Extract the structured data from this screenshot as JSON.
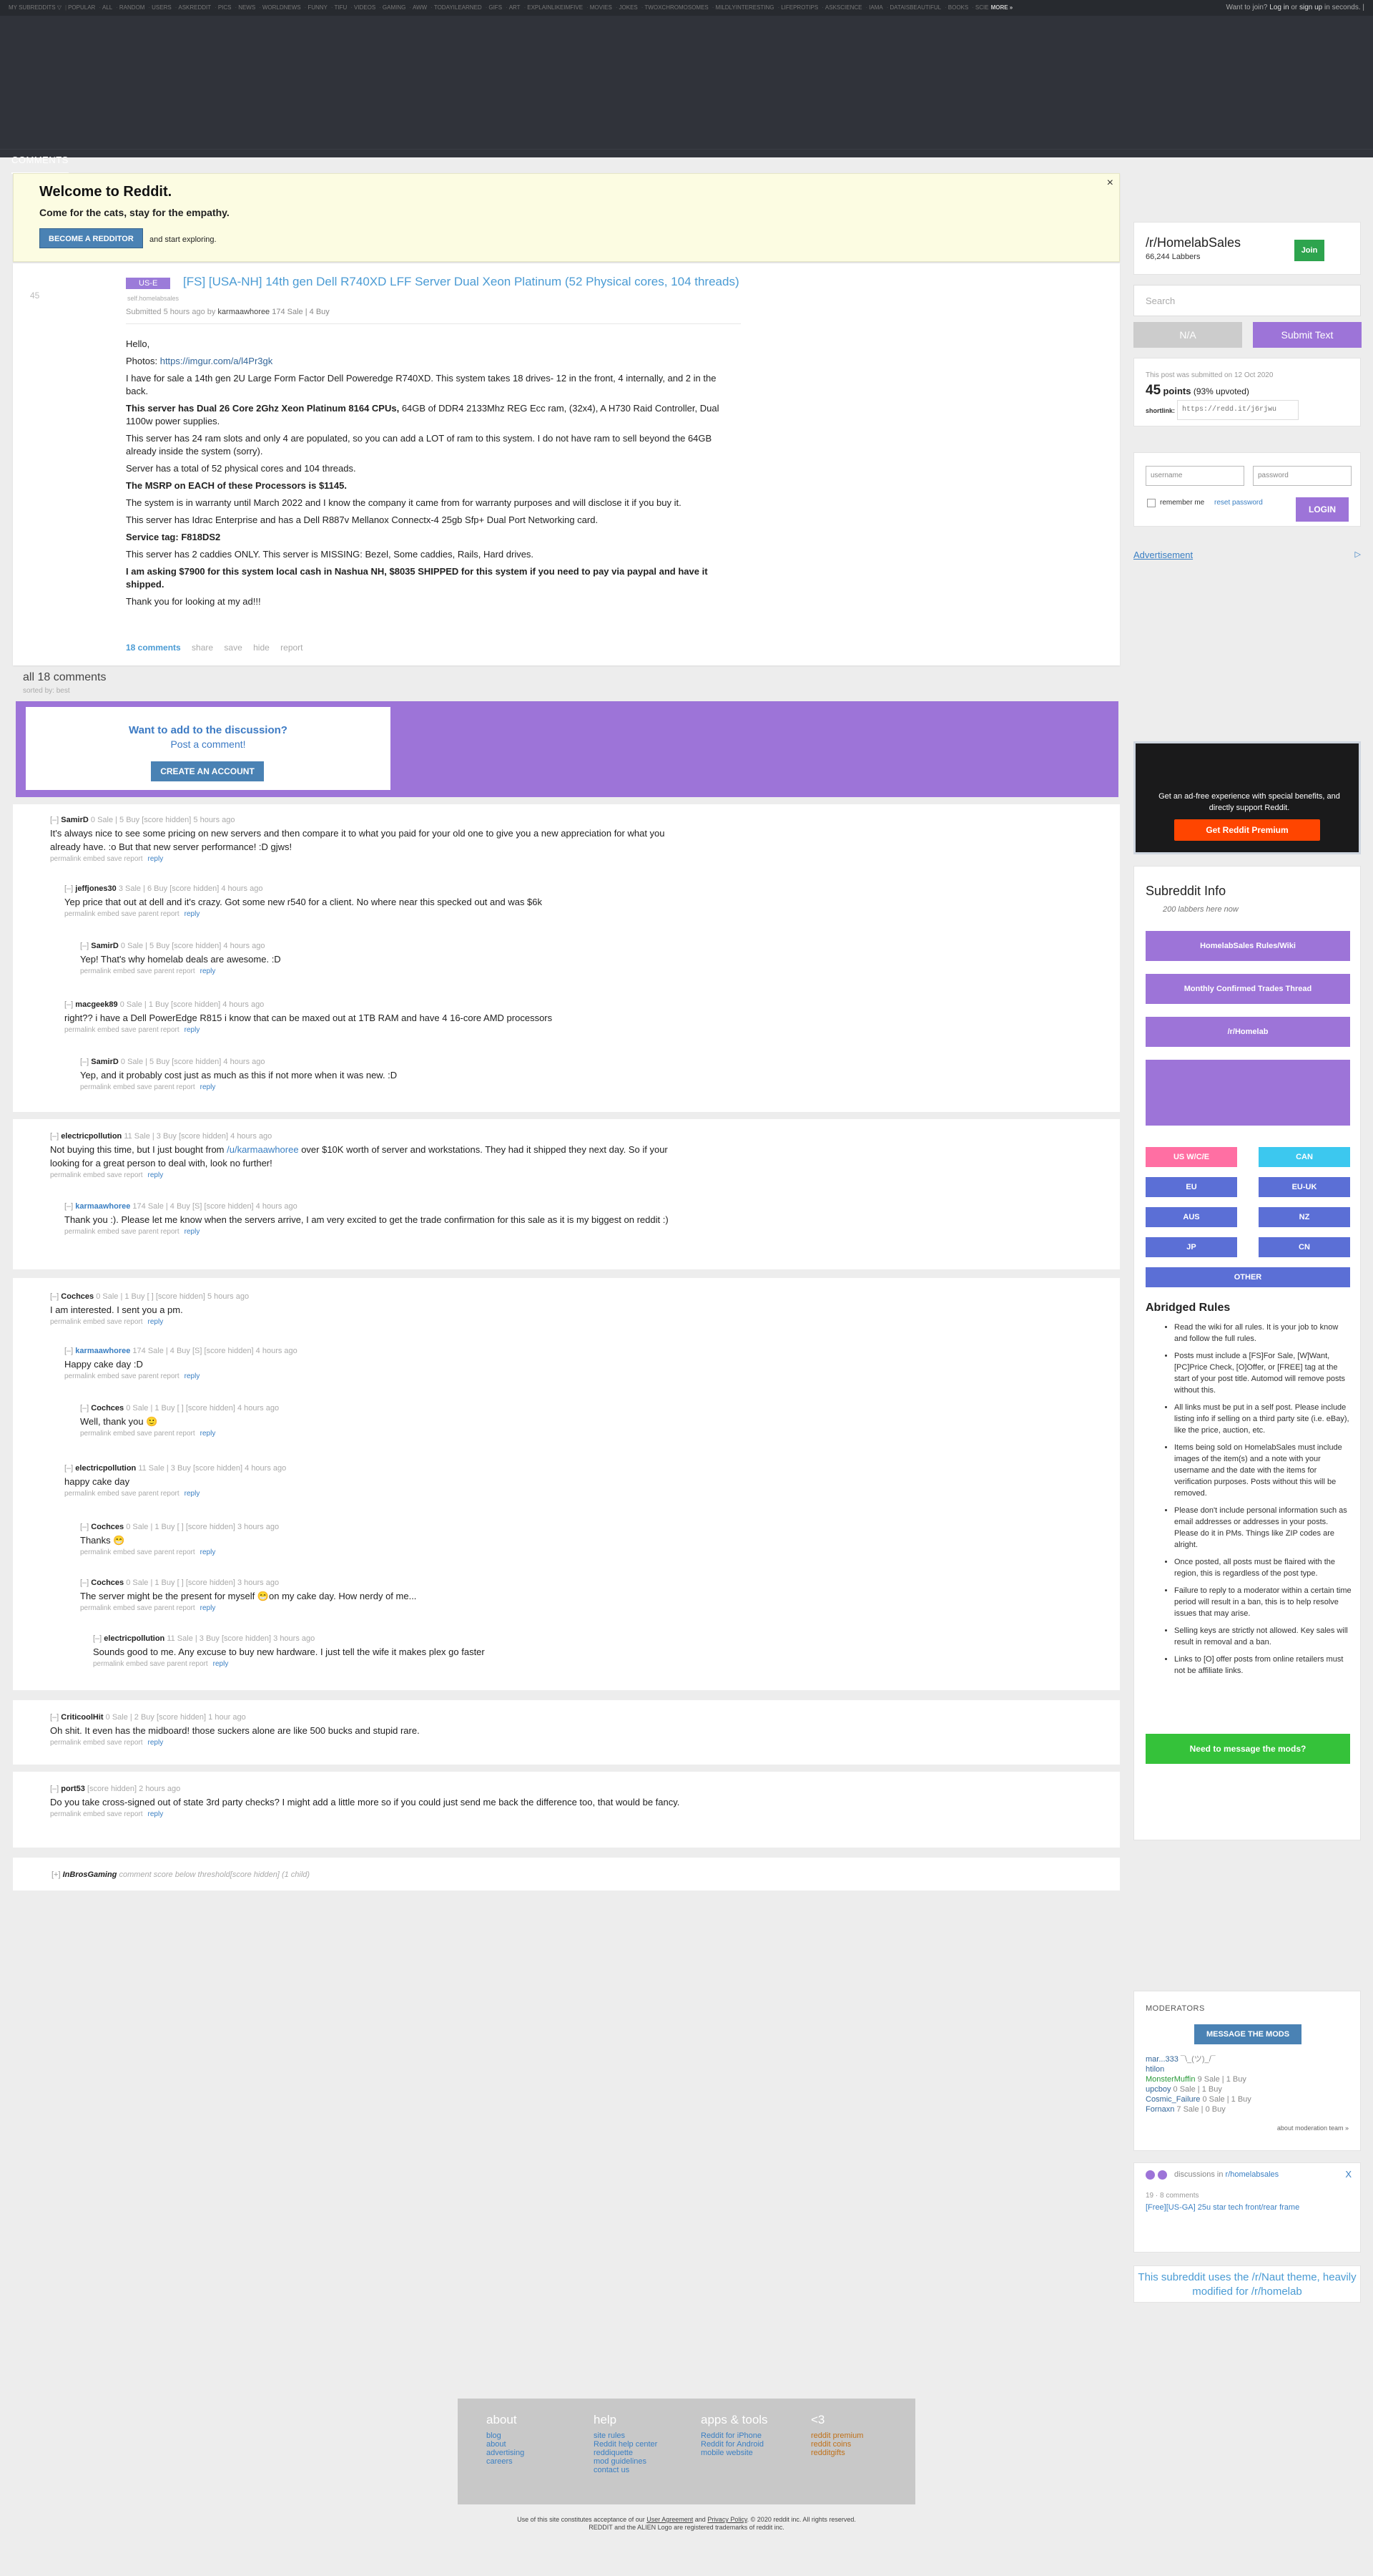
{
  "topbar": {
    "subreddits": [
      "MY SUBREDDITS ▽",
      "POPULAR",
      "ALL",
      "RANDOM",
      "USERS",
      "ASKREDDIT",
      "PICS",
      "NEWS",
      "WORLDNEWS",
      "FUNNY",
      "TIFU",
      "VIDEOS",
      "GAMING",
      "AWW",
      "TODAYILEARNED",
      "GIFS",
      "ART",
      "EXPLAINLIKEIMFIVE",
      "MOVIES",
      "JOKES",
      "TWOXCHROMOSOMES",
      "MILDLYINTERESTING",
      "LIFEPROTIPS",
      "ASKSCIENCE",
      "IAMA",
      "DATAISBEAUTIFUL",
      "BOOKS",
      "SCIE"
    ],
    "more": "MORE »",
    "user_pre": "Want to join?",
    "login": "Log in",
    "or": "or",
    "signup": "sign up",
    "user_post": "in seconds. |"
  },
  "nav": {
    "comments_tab": "COMMENTS"
  },
  "welcome": {
    "title": "Welcome to Reddit.",
    "subtitle": "Come for the cats, stay for the empathy.",
    "button": "BECOME A REDDITOR",
    "explore": "and start exploring.",
    "close": "×"
  },
  "post": {
    "rank": "45",
    "flair": "US-E",
    "title": "[FS] [USA-NH] 14th gen Dell R740XD LFF Server Dual Xeon Platinum (52 Physical cores, 104 threads)",
    "domain": "self.homelabsales",
    "submitted": "Submitted 5 hours ago by",
    "author": "karmaawhoree",
    "author_flair": "174 Sale | 4 Buy",
    "body": {
      "p1": "Hello,",
      "p2_pre": "Photos:",
      "p2_link": "https://imgur.com/a/l4Pr3gk",
      "p3": "I have for sale a 14th gen 2U Large Form Factor Dell Poweredge R740XD. This system takes 18 drives- 12 in the front, 4 internally, and 2 in the back.",
      "p4_bold": "This server has Dual 26 Core 2Ghz Xeon Platinum 8164 CPUs,",
      "p4_rest": " 64GB of DDR4 2133Mhz REG Ecc ram, (32x4), A H730 Raid Controller, Dual 1100w power supplies.",
      "p5": "This server has 24 ram slots and only 4 are populated, so you can add a LOT of ram to this system. I do not have ram to sell beyond the 64GB already inside the system (sorry).",
      "p6": "Server has a total of 52 physical cores and 104 threads.",
      "p7": "The MSRP on EACH of these Processors is $1145.",
      "p8": "The system is in warranty until March 2022 and I know the company it came from for warranty purposes and will disclose it if you buy it.",
      "p9": "This server has Idrac Enterprise and has a Dell R887v Mellanox Connectx-4 25gb Sfp+ Dual Port Networking card.",
      "p10": "Service tag: F818DS2",
      "p11": "This server has 2 caddies ONLY. This server is MISSING: Bezel, Some caddies, Rails, Hard drives.",
      "p12": "I am asking $7900 for this system local cash in Nashua NH, $8035 SHIPPED for this system if you need to pay via paypal and have it shipped.",
      "p13": "Thank you for looking at my ad!!!"
    },
    "actions": {
      "comments": "18 comments",
      "share": "share",
      "save": "save",
      "hide": "hide",
      "report": "report"
    }
  },
  "comments_area": {
    "count": "all 18 comments",
    "sorted": "sorted by: best"
  },
  "discuss": {
    "question": "Want to add to the discussion?",
    "post": "Post a comment!",
    "button": "CREATE AN ACCOUNT"
  },
  "comments": [
    {
      "author": "SamirD",
      "flair": "0 Sale | 5 Buy",
      "meta": "[score hidden] 5 hours ago",
      "text": "It's always nice to see some pricing on new servers and then compare it to what you paid for your old one to give you a new appreciation for what you already have. :o But that new server performance! :D gjws!",
      "actions": "permalink   embed   save   report"
    },
    {
      "author": "jeffjones30",
      "flair": "3 Sale | 6 Buy",
      "meta": "[score hidden] 4 hours ago",
      "text": "Yep price that out at dell and it's crazy. Got some new r540 for a client. No where near this specked out and was $6k",
      "actions": "permalink   embed   save   parent   report"
    },
    {
      "author": "SamirD",
      "flair": "0 Sale | 5 Buy",
      "meta": "[score hidden] 4 hours ago",
      "text": "Yep! That's why homelab deals are awesome. :D",
      "actions": "permalink   embed   save   parent   report"
    },
    {
      "author": "macgeek89",
      "flair": "0 Sale | 1 Buy",
      "meta": "[score hidden] 4 hours ago",
      "text": "right?? i have a Dell PowerEdge R815 i know that can be maxed out at 1TB RAM and have 4 16-core AMD processors",
      "actions": "permalink   embed   save   parent   report"
    },
    {
      "author": "SamirD",
      "flair": "0 Sale | 5 Buy",
      "meta": "[score hidden] 4 hours ago",
      "text": "Yep, and it probably cost just as much as this if not more when it was new. :D",
      "actions": "permalink   embed   save   parent   report"
    },
    {
      "author": "electricpollution",
      "flair": "11 Sale | 3 Buy",
      "meta": "[score hidden] 4 hours ago",
      "text_pre": "Not buying this time, but I just bought from ",
      "text_link": "/u/karmaawhoree",
      "text_post": " over $10K worth of server and workstations. They had it shipped they next day. So if your looking for a great person to deal with, look no further!",
      "actions": "permalink   embed   save   report"
    },
    {
      "author": "karmaawhoree",
      "flair": "174 Sale | 4 Buy",
      "mark": "[S]",
      "meta": "[score hidden] 4 hours ago",
      "text": "Thank you :). Please let me know when the servers arrive, I am very excited to get the trade confirmation for this sale as it is my biggest on reddit :)",
      "actions": "permalink   embed   save   parent   report"
    },
    {
      "author": "Cochces",
      "flair": "0 Sale | 1 Buy",
      "mark": "[ ]",
      "meta": "[score hidden] 5 hours ago",
      "text": "I am interested. I sent you a pm.",
      "actions": "permalink   embed   save   report"
    },
    {
      "author": "karmaawhoree",
      "flair": "174 Sale | 4 Buy",
      "mark": "[S]",
      "meta": "[score hidden] 4 hours ago",
      "text": "Happy cake day :D",
      "actions": "permalink   embed   save   parent   report"
    },
    {
      "author": "Cochces",
      "flair": "0 Sale | 1 Buy",
      "mark": "[ ]",
      "meta": "[score hidden] 4 hours ago",
      "text": "Well, thank you 🙂",
      "actions": "permalink   embed   save   parent   report"
    },
    {
      "author": "electricpollution",
      "flair": "11 Sale | 3 Buy",
      "meta": "[score hidden] 4 hours ago",
      "text": "happy cake day",
      "actions": "permalink   embed   save   parent   report"
    },
    {
      "author": "Cochces",
      "flair": "0 Sale | 1 Buy",
      "mark": "[ ]",
      "meta": "[score hidden] 3 hours ago",
      "text": "Thanks 😁",
      "actions": "permalink   embed   save   parent   report"
    },
    {
      "author": "Cochces",
      "flair": "0 Sale | 1 Buy",
      "mark": "[ ]",
      "meta": "[score hidden] 3 hours ago",
      "text": "The server might be the present for myself 😁on my cake day. How nerdy of me...",
      "actions": "permalink   embed   save   parent   report"
    },
    {
      "author": "electricpollution",
      "flair": "11 Sale | 3 Buy",
      "meta": "[score hidden] 3 hours ago",
      "text": "Sounds good to me. Any excuse to buy new hardware. I just tell the wife it makes plex go faster",
      "actions": "permalink   embed   save   parent   report"
    },
    {
      "author": "CriticoolHit",
      "flair": "0 Sale | 2 Buy",
      "meta": "[score hidden] 1 hour ago",
      "text": "Oh shit. It even has the midboard! those suckers alone are like 500 bucks and stupid rare.",
      "actions": "permalink   embed   save   report"
    },
    {
      "author": "port53",
      "flair": "",
      "meta": "[score hidden] 2 hours ago",
      "text": "Do you take cross-signed out of state 3rd party checks? I might add a little more so if you could just send me back the difference too, that would be fancy.",
      "actions": "permalink   embed   save   report"
    }
  ],
  "collapsed": {
    "toggle": "[+]",
    "author": "InBrosGaming",
    "note": "comment score below threshold",
    "meta": "[score hidden]",
    "children": "(1 child)"
  },
  "common": {
    "toggle": "[–]",
    "reply": "reply"
  },
  "sidebar": {
    "subreddit": "/r/HomelabSales",
    "members": "66,244 Labbers",
    "join": "Join",
    "search_placeholder": "Search",
    "na": "N/A",
    "submit": "Submit Text",
    "submitted_on": "This post was submitted on 12 Oct 2020",
    "points": "45",
    "points_label": "points",
    "upvoted": "(93% upvoted)",
    "shortlink_label": "shortlink:",
    "shortlink": "https://redd.it/j6rjwu",
    "username": "username",
    "password": "password",
    "remember": "remember me",
    "reset": "reset password",
    "login": "LOGIN",
    "ad": "Advertisement",
    "ad_icon": "▷",
    "premium_text": "Get an ad-free experience with special benefits, and directly support Reddit.",
    "premium_button": "Get Reddit Premium",
    "info_title": "Subreddit Info",
    "info_note": "200 labbers here now",
    "links": [
      "HomelabSales Rules/Wiki",
      "Monthly Confirmed Trades Thread",
      "/r/Homelab"
    ],
    "regions": [
      {
        "label": "US W/C/E",
        "color": "#ff6fa3"
      },
      {
        "label": "CAN",
        "color": "#3cc8ef"
      },
      {
        "label": "EU",
        "color": "#5b6fd6"
      },
      {
        "label": "EU-UK",
        "color": "#5b6fd6"
      },
      {
        "label": "AUS",
        "color": "#5b6fd6"
      },
      {
        "label": "NZ",
        "color": "#5b6fd6"
      },
      {
        "label": "JP",
        "color": "#5b6fd6"
      },
      {
        "label": "CN",
        "color": "#5b6fd6"
      }
    ],
    "other": "OTHER",
    "rules_title": "Abridged Rules",
    "rules": [
      "Read the wiki for all rules. It is your job to know and follow the full rules.",
      "Posts must include a [FS]For Sale, [W]Want, [PC]Price Check, [O]Offer, or [FREE] tag at the start of your post title. Automod will remove posts without this.",
      "All links must be put in a self post. Please include listing info if selling on a third party site (i.e. eBay), like the price, auction, etc.",
      "Items being sold on HomelabSales must include images of the item(s) and a note with your username and the date with the items for verification purposes. Posts without this will be removed.",
      "Please don't include personal information such as email addresses or addresses in your posts. Please do it in PMs. Things like ZIP codes are alright.",
      "Once posted, all posts must be flaired with the region, this is regardless of the post type.",
      "Failure to reply to a moderator within a certain time period will result in a ban, this is to help resolve issues that may arise.",
      "Selling keys are strictly not allowed. Key sales will result in removal and a ban.",
      "Links to [O] offer posts from online retailers must not be affiliate links."
    ],
    "message_mods": "Need to message the mods?",
    "moderators_title": "MODERATORS",
    "message_the_mods": "MESSAGE THE MODS",
    "moderators": [
      {
        "name": "mar...333",
        "flair": "¯\\_(ツ)_/¯"
      },
      {
        "name": "htilon",
        "flair": ""
      },
      {
        "name": "MonsterMuffin",
        "flair": "9 Sale | 1 Buy"
      },
      {
        "name": "upcboy",
        "flair": "0 Sale | 1 Buy"
      },
      {
        "name": "Cosmic_Failure",
        "flair": "0 Sale | 1 Buy"
      },
      {
        "name": "Fornaxn",
        "flair": "7 Sale | 0 Buy"
      }
    ],
    "about_mods": "about moderation team »",
    "disc_label": "discussions in",
    "disc_sub": "r/homelabsales",
    "disc_close": "X",
    "disc_meta": "19 · 8 comments",
    "disc_link": "[Free][US-GA] 25u star tech front/rear frame",
    "theme": "This subreddit uses the /r/Naut theme, heavily modified for /r/homelab"
  },
  "footer": {
    "cols": [
      {
        "title": "about",
        "links": [
          "blog",
          "about",
          "advertising",
          "careers"
        ]
      },
      {
        "title": "help",
        "links": [
          "site rules",
          "Reddit help center",
          "reddiquette",
          "mod guidelines",
          "contact us"
        ]
      },
      {
        "title": "apps & tools",
        "links": [
          "Reddit for iPhone",
          "Reddit for Android",
          "mobile website"
        ]
      },
      {
        "title": "<3",
        "links": [
          "reddit premium",
          "reddit coins",
          "redditgifts"
        ]
      }
    ],
    "copy1_pre": "Use of this site constitutes acceptance of our",
    "ua": "User Agreement",
    "and": "and",
    "pp": "Privacy Policy",
    "copy1_post": ". © 2020 reddit inc. All rights reserved.",
    "copy2": "REDDIT and the ALIEN Logo are registered trademarks of reddit inc."
  }
}
